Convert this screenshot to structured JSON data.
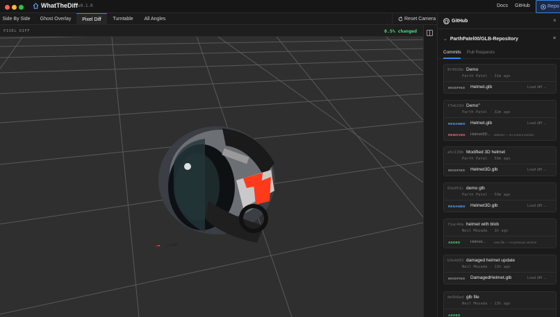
{
  "app": {
    "title": "WhatTheDiff",
    "version": "v0.1.0",
    "nav": [
      "Docs",
      "GitHub"
    ],
    "repo_button_label": "Repo"
  },
  "view_tabs": [
    {
      "label": "Side By Side",
      "active": false
    },
    {
      "label": "Ghost Overlay",
      "active": false
    },
    {
      "label": "Pixel Diff",
      "active": true
    },
    {
      "label": "Turntable",
      "active": false
    },
    {
      "label": "All Angles",
      "active": false
    }
  ],
  "reset_camera_label": "Reset Camera",
  "viewport": {
    "mode_label": "PIXEL DIFF",
    "changed_label": "0.5% changed"
  },
  "github_panel": {
    "title": "GitHub",
    "close_icon": "×",
    "repo_name": "ParthPatel00/GLB-Repository",
    "tabs": [
      {
        "label": "Commits",
        "active": true
      },
      {
        "label": "Pull Requests",
        "active": false
      }
    ],
    "commits": [
      {
        "sha": "8f4910e",
        "message": "Demo",
        "meta": "Parth Patel · 31m ago",
        "files": [
          {
            "status": "MODIFIED",
            "name": "Helmet.glb",
            "action": "Load diff →"
          }
        ]
      },
      {
        "sha": "f7eb13d",
        "message": "Demo\"",
        "meta": "Parth Patel · 32m ago",
        "files": [
          {
            "status": "RENAMED",
            "name": "Helmet.glb",
            "action": "Load diff →"
          },
          {
            "status": "REMOVED",
            "name": "Helmet3D...",
            "note": "deleted — no current version"
          }
        ]
      },
      {
        "sha": "a5c139b",
        "message": "Modified 3D helmet",
        "meta": "Parth Patel · 59m ago",
        "files": [
          {
            "status": "MODIFIED",
            "name": "Helmet3D.glb",
            "action": "Load diff →"
          }
        ]
      },
      {
        "sha": "63e951c",
        "message": "demo glb",
        "meta": "Parth Patel · 59m ago",
        "files": [
          {
            "status": "RENAMED",
            "name": "Helmet3D.glb",
            "action": "Load diff →"
          }
        ]
      },
      {
        "sha": "f1ac4da",
        "message": "helmet with blob",
        "meta": "Neil Mouada · 1h ago",
        "files": [
          {
            "status": "ADDED",
            "name": "Helmet...",
            "note": "new file — no previous version"
          }
        ]
      },
      {
        "sha": "b3e4d93",
        "message": "damaged helmet update",
        "meta": "Neil Mouada · 13h ago",
        "files": [
          {
            "status": "MODIFIED",
            "name": "DamagedHelmet.glb",
            "action": "Load diff →"
          }
        ]
      },
      {
        "sha": "de5b6ed",
        "message": "glb file",
        "meta": "Neil Mouada · 13h ago",
        "files": [
          {
            "status": "ADDED",
            "name": "",
            "note": ""
          }
        ]
      }
    ]
  },
  "colors": {
    "accent": "#3b82f6",
    "changed": "#4ade80",
    "modified": "#9a9a9a",
    "renamed": "#60a5fa",
    "removed": "#f87171",
    "added": "#4ade80"
  }
}
